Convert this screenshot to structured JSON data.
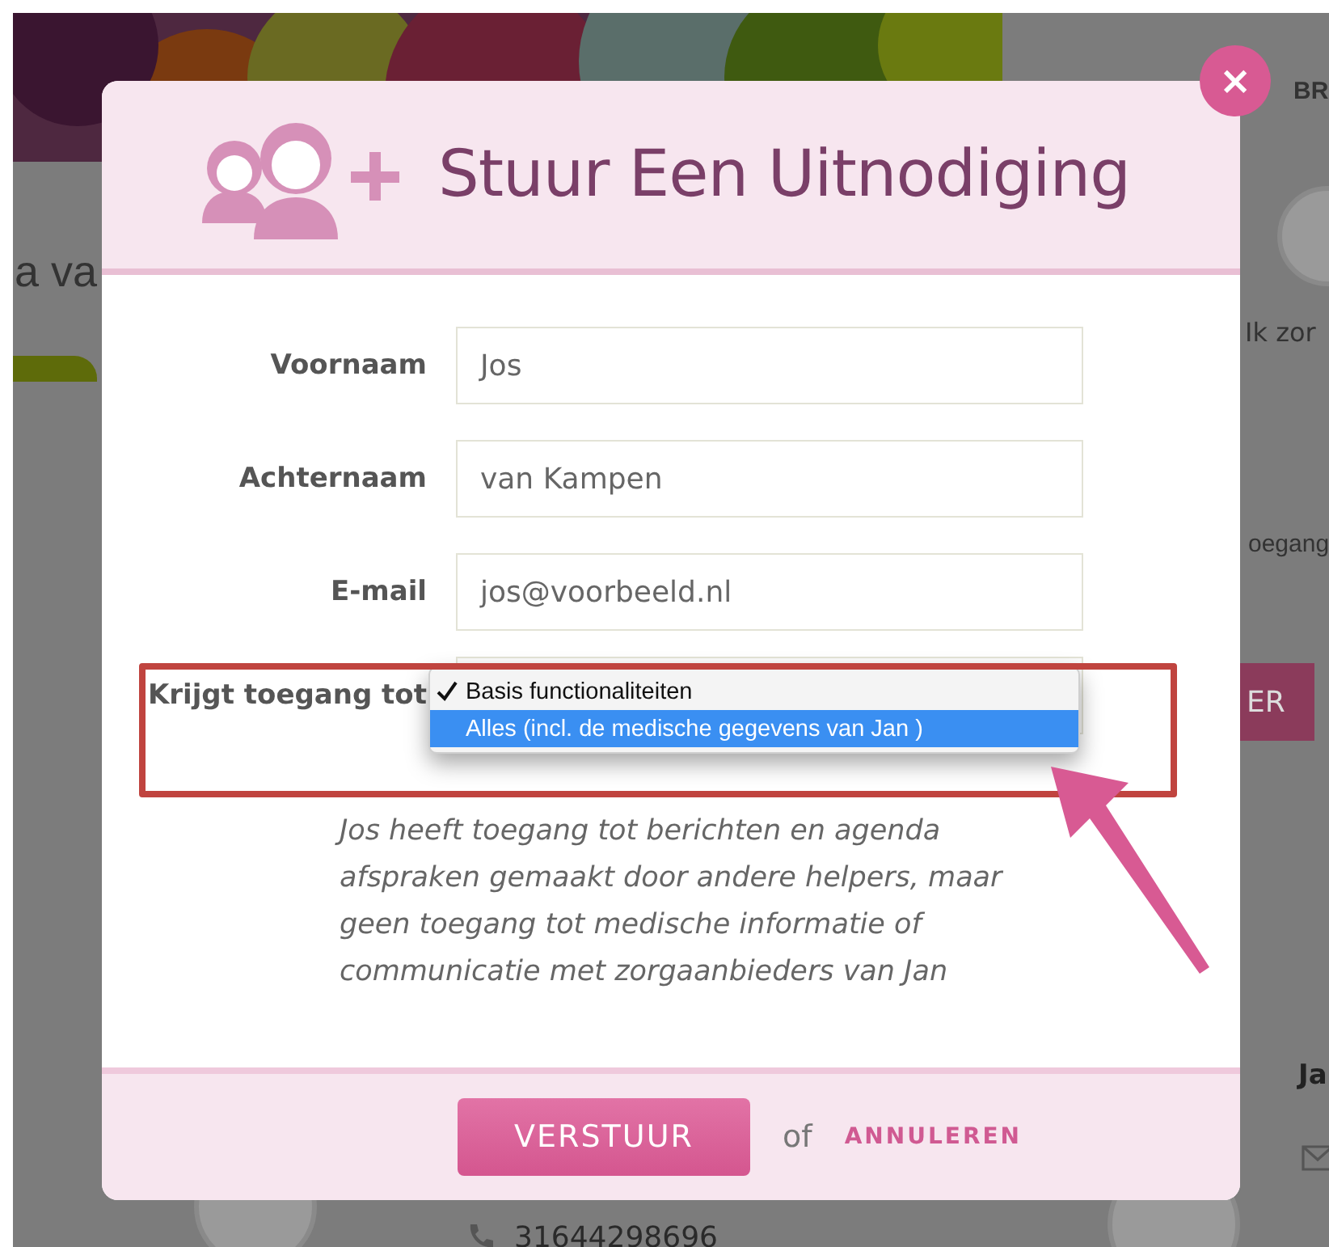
{
  "background": {
    "nav_item": "BR",
    "heading": "a va",
    "side_caption": "Ik zor",
    "side_text": "oegang",
    "side_button": "ER",
    "contact_name": "Ja",
    "phone": "31644298696"
  },
  "dialog": {
    "close": "×",
    "title": "Stuur Een Uitnodiging",
    "fields": [
      {
        "label": "Voornaam",
        "value": "Jos"
      },
      {
        "label": "Achternaam",
        "value": "van Kampen"
      },
      {
        "label": "E-mail",
        "value": "jos@voorbeeld.nl"
      }
    ],
    "access": {
      "label": "Krijgt toegang tot",
      "options": [
        {
          "label": "Basis functionaliteiten",
          "checked": true,
          "selected": false
        },
        {
          "label": "Alles (incl. de medische gegevens van Jan )",
          "checked": false,
          "selected": true
        }
      ]
    },
    "description": "Jos heeft toegang tot berichten en agenda afspraken gemaakt door andere helpers, maar geen toegang tot medische informatie of communicatie met zorgaanbieders van Jan",
    "submit": "VERSTUUR",
    "separator": "of",
    "cancel": "ANNULEREN"
  }
}
